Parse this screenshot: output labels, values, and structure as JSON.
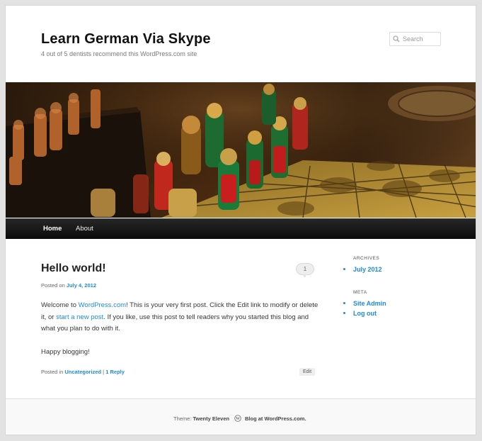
{
  "site": {
    "title": "Learn German Via Skype",
    "description": "4 out of 5 dentists recommend this WordPress.com site"
  },
  "search": {
    "placeholder": "Search"
  },
  "nav": {
    "items": [
      "Home",
      "About"
    ]
  },
  "post": {
    "title": "Hello world!",
    "comment_count": "1",
    "posted_on_label": "Posted on",
    "date": "July 4, 2012",
    "p1_a": "Welcome to ",
    "p1_link1": "WordPress.com",
    "p1_b": "! This is your very first post. Click the Edit link to modify or delete it, or ",
    "p1_link2": "start a new post",
    "p1_c": ". If you like, use this post to tell readers why you started this blog and what you plan to do with it.",
    "p2": "Happy blogging!",
    "posted_in_label": "Posted in",
    "category": "Uncategorized",
    "separator": "|",
    "reply_link": "1 Reply",
    "edit_label": "Edit"
  },
  "sidebar": {
    "archives_title": "ARCHIVES",
    "archives": [
      "July 2012"
    ],
    "meta_title": "META",
    "meta": [
      "Site Admin",
      "Log out"
    ]
  },
  "footer": {
    "theme_label": "Theme:",
    "theme_name": "Twenty Eleven",
    "blog_link": "Blog at WordPress.com."
  },
  "colors": {
    "link": "#1b8be0",
    "nav_bg": "#111111",
    "page_bg": "#e2e2e2"
  },
  "icons": [
    "search-icon",
    "wordpress-icon",
    "comment-bubble-icon"
  ]
}
